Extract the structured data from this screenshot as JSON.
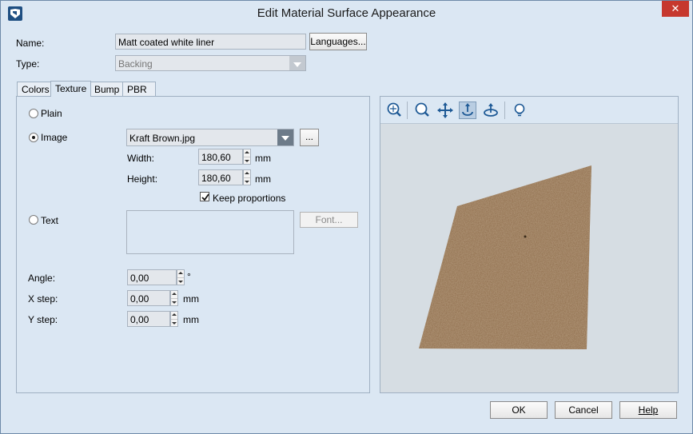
{
  "window": {
    "title": "Edit Material Surface Appearance",
    "close_glyph": "✕",
    "icon": "app-logo-icon"
  },
  "name": {
    "label": "Name:",
    "value": "Matt coated white liner",
    "languages_label": "Languages..."
  },
  "type": {
    "label": "Type:",
    "value": "Backing"
  },
  "tabs": [
    {
      "label": "Colors"
    },
    {
      "label": "Texture"
    },
    {
      "label": "Bump"
    },
    {
      "label": "PBR"
    }
  ],
  "active_tab": "Texture",
  "texture": {
    "plain_label": "Plain",
    "image_label": "Image",
    "image_file": "Kraft Brown.jpg",
    "browse_label": "...",
    "width_label": "Width:",
    "width_value": "180,60",
    "width_unit": "mm",
    "height_label": "Height:",
    "height_value": "180,60",
    "height_unit": "mm",
    "keep_proportions_label": "Keep proportions",
    "keep_proportions_checked": true,
    "text_label": "Text",
    "font_label": "Font...",
    "selected_mode": "Image"
  },
  "transform": {
    "angle_label": "Angle:",
    "angle_value": "0,00",
    "angle_unit": "°",
    "xstep_label": "X step:",
    "xstep_value": "0,00",
    "xstep_unit": "mm",
    "ystep_label": "Y step:",
    "ystep_value": "0,00",
    "ystep_unit": "mm"
  },
  "preview_toolbar": [
    {
      "name": "zoom-fit-icon"
    },
    {
      "name": "zoom-icon"
    },
    {
      "name": "pan-icon"
    },
    {
      "name": "rotate-icon",
      "pressed": true
    },
    {
      "name": "orbit-icon"
    },
    {
      "name": "light-bulb-icon"
    }
  ],
  "preview": {
    "texture_color": "#8c6a48"
  },
  "footer": {
    "ok_label": "OK",
    "cancel_label": "Cancel",
    "help_label": "Help"
  }
}
